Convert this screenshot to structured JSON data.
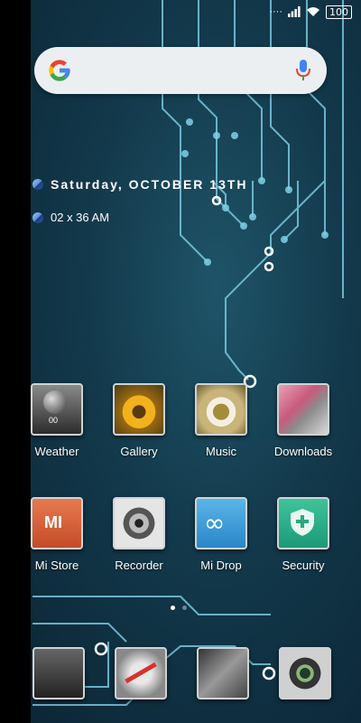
{
  "status_bar": {
    "battery": "100"
  },
  "search": {
    "colors": {
      "g_blue": "#4285F4",
      "g_red": "#EA4335",
      "g_yellow": "#FBBC05",
      "g_green": "#34A853"
    }
  },
  "widget": {
    "date": "Saturday, OCTOBER 13TH",
    "time": "02 x 36 AM"
  },
  "apps": [
    {
      "label": "Weather",
      "icon": "weather-icon"
    },
    {
      "label": "Gallery",
      "icon": "gallery-icon"
    },
    {
      "label": "Music",
      "icon": "music-icon"
    },
    {
      "label": "Downloads",
      "icon": "downloads-icon"
    },
    {
      "label": "Mi Store",
      "icon": "mi-store-icon"
    },
    {
      "label": "Recorder",
      "icon": "recorder-icon"
    },
    {
      "label": "Mi Drop",
      "icon": "mi-drop-icon"
    },
    {
      "label": "Security",
      "icon": "security-icon"
    }
  ],
  "weather_icon_text": "00",
  "page_indicator": {
    "count": 2,
    "active": 0
  },
  "dock": [
    {
      "icon": "calculator-icon"
    },
    {
      "icon": "compass-icon"
    },
    {
      "icon": "keyboard-icon"
    },
    {
      "icon": "camera-icon"
    }
  ]
}
